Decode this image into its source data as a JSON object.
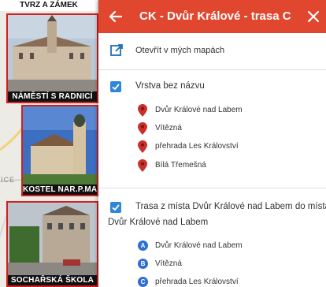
{
  "map": {
    "captions": {
      "top": "TVRZ A ZÁMEK",
      "card1": "NÁMĚSTÍ S RADNICÍ",
      "card2": "KOSTEL NAR.P.MARIE",
      "card3": "SOCHAŘSKÁ ŠKOLA"
    },
    "side_label": "ICE"
  },
  "panel": {
    "title": "CK - Dvůr Králové - trasa C",
    "open_in_maps": "Otevřít v mých mapách",
    "layer1": {
      "title": "Vrstva bez názvu",
      "places": [
        {
          "label": "Dvůr Králové nad Labem"
        },
        {
          "label": "Vítězná"
        },
        {
          "label": "přehrada Les Království"
        },
        {
          "label": "Bílá Třemešná"
        }
      ]
    },
    "layer2": {
      "title_line1": "Trasa z místa Dvůr Králové nad Labem do místa",
      "title_line2": "Dvůr Králové nad Labem",
      "stops": [
        {
          "marker": "A",
          "label": "Dvůr Králové nad Labem"
        },
        {
          "marker": "B",
          "label": "Vítězná"
        },
        {
          "marker": "C",
          "label": "přehrada Les Království"
        }
      ]
    }
  },
  "colors": {
    "header": "#e1472e",
    "checkbox": "#2f86d6",
    "pin": "#c9302c",
    "route_marker": "#2f6fd1"
  }
}
